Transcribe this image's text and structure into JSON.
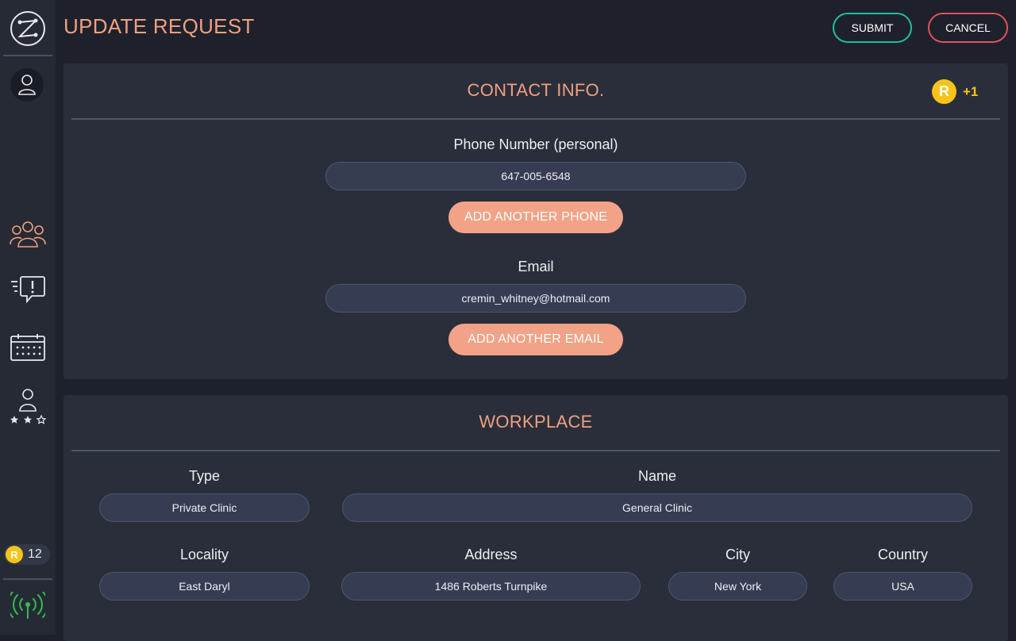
{
  "header": {
    "title": "UPDATE REQUEST",
    "submit_label": "SUBMIT",
    "cancel_label": "CANCEL"
  },
  "sidebar": {
    "items": [
      {
        "icon": "logo-icon"
      },
      {
        "icon": "user-icon"
      },
      {
        "icon": "people-group-icon"
      },
      {
        "icon": "alert-message-icon"
      },
      {
        "icon": "calendar-icon"
      },
      {
        "icon": "rated-user-icon"
      }
    ],
    "coin_letter": "R",
    "coin_count": "12",
    "signal_icon": "signal-antenna-icon"
  },
  "contact": {
    "title": "CONTACT INFO.",
    "reward_letter": "R",
    "reward_label": "+1",
    "phone_label": "Phone Number (personal)",
    "phone_value": "647-005-6548",
    "add_phone_label": "ADD ANOTHER PHONE",
    "email_label": "Email",
    "email_value": "cremin_whitney@hotmail.com",
    "add_email_label": "ADD ANOTHER EMAIL"
  },
  "workplace": {
    "title": "WORKPLACE",
    "type_label": "Type",
    "type_value": "Private Clinic",
    "name_label": "Name",
    "name_value": "General Clinic",
    "locality_label": "Locality",
    "locality_value": "East Daryl",
    "address_label": "Address",
    "address_value": "1486 Roberts Turnpike",
    "city_label": "City",
    "city_value": "New York",
    "country_label": "Country",
    "country_value": "USA"
  },
  "colors": {
    "accent": "#f0a07f",
    "submit_border": "#1fbfa0",
    "cancel_border": "#e0535a",
    "coin": "#f7c31a",
    "signal": "#2fbf4f"
  }
}
